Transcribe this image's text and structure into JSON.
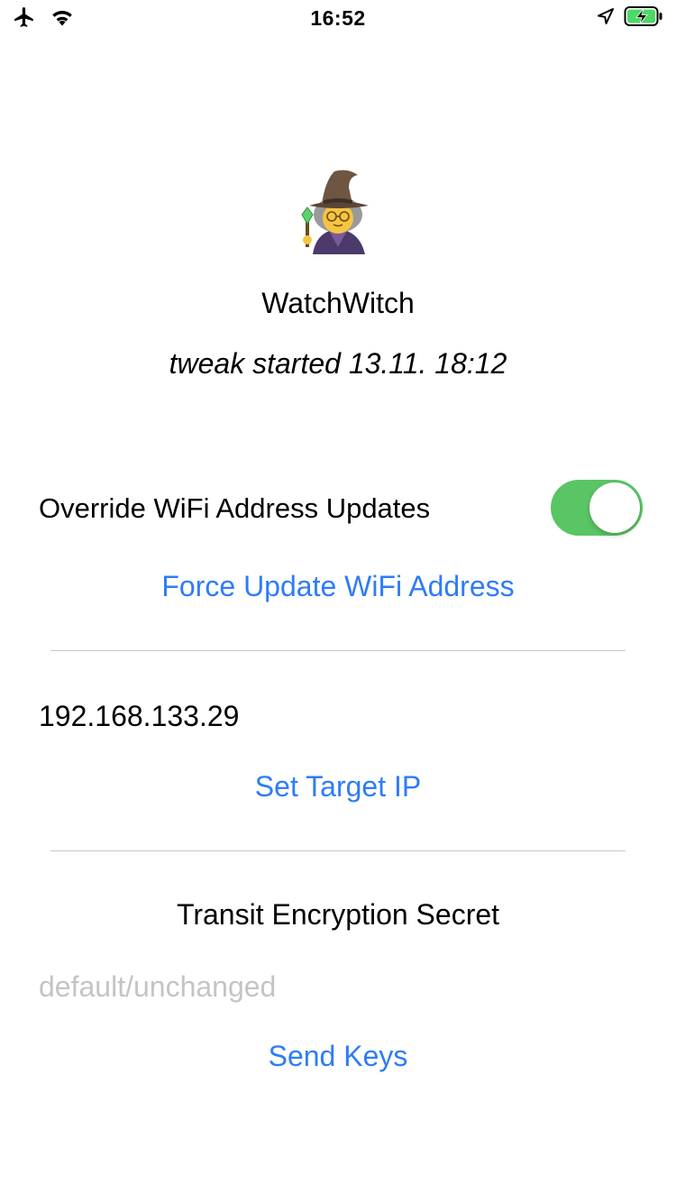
{
  "status_bar": {
    "time": "16:52",
    "icons": [
      "airplane-icon",
      "wifi-icon",
      "location-icon",
      "battery-charging-icon"
    ],
    "battery_color": "#4cd964"
  },
  "app": {
    "icon": "🧙‍♀️",
    "title": "WatchWitch",
    "subtitle": "tweak started 13.11. 18:12"
  },
  "wifi_override": {
    "label": "Override WiFi Address Updates",
    "enabled": true,
    "toggle_color": "#5ac564",
    "force_button": "Force Update WiFi Address"
  },
  "target": {
    "ip": "192.168.133.29",
    "set_button": "Set Target IP"
  },
  "secret": {
    "title": "Transit Encryption Secret",
    "value": "",
    "placeholder": "default/unchanged",
    "send_button": "Send Keys"
  },
  "colors": {
    "accent": "#2f7cf6",
    "divider": "#c8c8cc",
    "placeholder": "#c4c4c6"
  }
}
